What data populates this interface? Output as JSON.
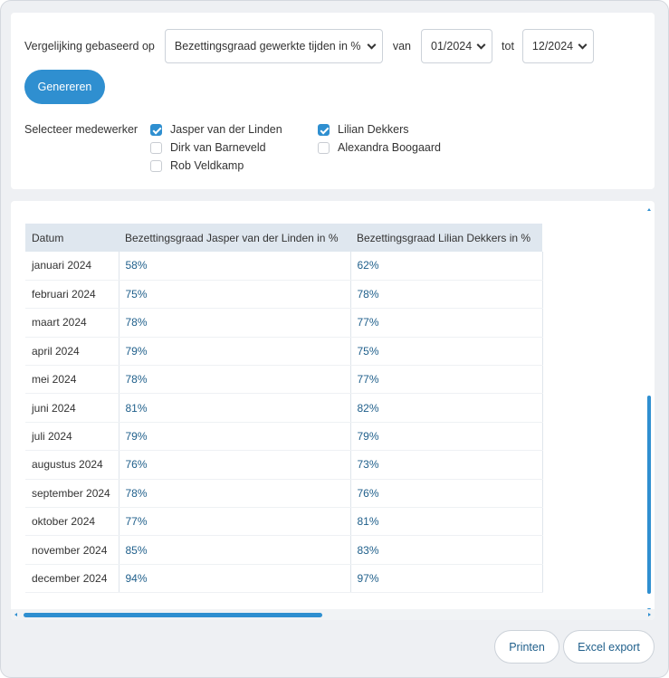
{
  "filters": {
    "compare_label": "Vergelijking gebaseerd op",
    "compare_value": "Bezettingsgraad gewerkte tijden in %",
    "from_label": "van",
    "from_value": "01/2024",
    "to_label": "tot",
    "to_value": "12/2024",
    "generate_label": "Genereren"
  },
  "employees": {
    "label": "Selecteer medewerker",
    "items": [
      {
        "name": "Jasper van der Linden",
        "checked": true
      },
      {
        "name": "Lilian Dekkers",
        "checked": true
      },
      {
        "name": "Dirk van Barneveld",
        "checked": false
      },
      {
        "name": "Alexandra Boogaard",
        "checked": false
      },
      {
        "name": "Rob Veldkamp",
        "checked": false
      }
    ]
  },
  "table": {
    "headers": [
      "Datum",
      "Bezettingsgraad Jasper van der Linden in %",
      "Bezettingsgraad Lilian Dekkers in %"
    ],
    "rows": [
      [
        "januari 2024",
        "58%",
        "62%"
      ],
      [
        "februari 2024",
        "75%",
        "78%"
      ],
      [
        "maart 2024",
        "78%",
        "77%"
      ],
      [
        "april 2024",
        "79%",
        "75%"
      ],
      [
        "mei 2024",
        "78%",
        "77%"
      ],
      [
        "juni 2024",
        "81%",
        "82%"
      ],
      [
        "juli 2024",
        "79%",
        "79%"
      ],
      [
        "augustus 2024",
        "76%",
        "73%"
      ],
      [
        "september 2024",
        "78%",
        "76%"
      ],
      [
        "oktober 2024",
        "77%",
        "81%"
      ],
      [
        "november 2024",
        "85%",
        "83%"
      ],
      [
        "december 2024",
        "94%",
        "97%"
      ]
    ]
  },
  "actions": {
    "print_label": "Printen",
    "export_label": "Excel export"
  },
  "colors": {
    "accent": "#2f8fd0",
    "header_bg": "#dfe7ef",
    "value_text": "#1f5f8b",
    "page_bg": "#eef0f3"
  }
}
